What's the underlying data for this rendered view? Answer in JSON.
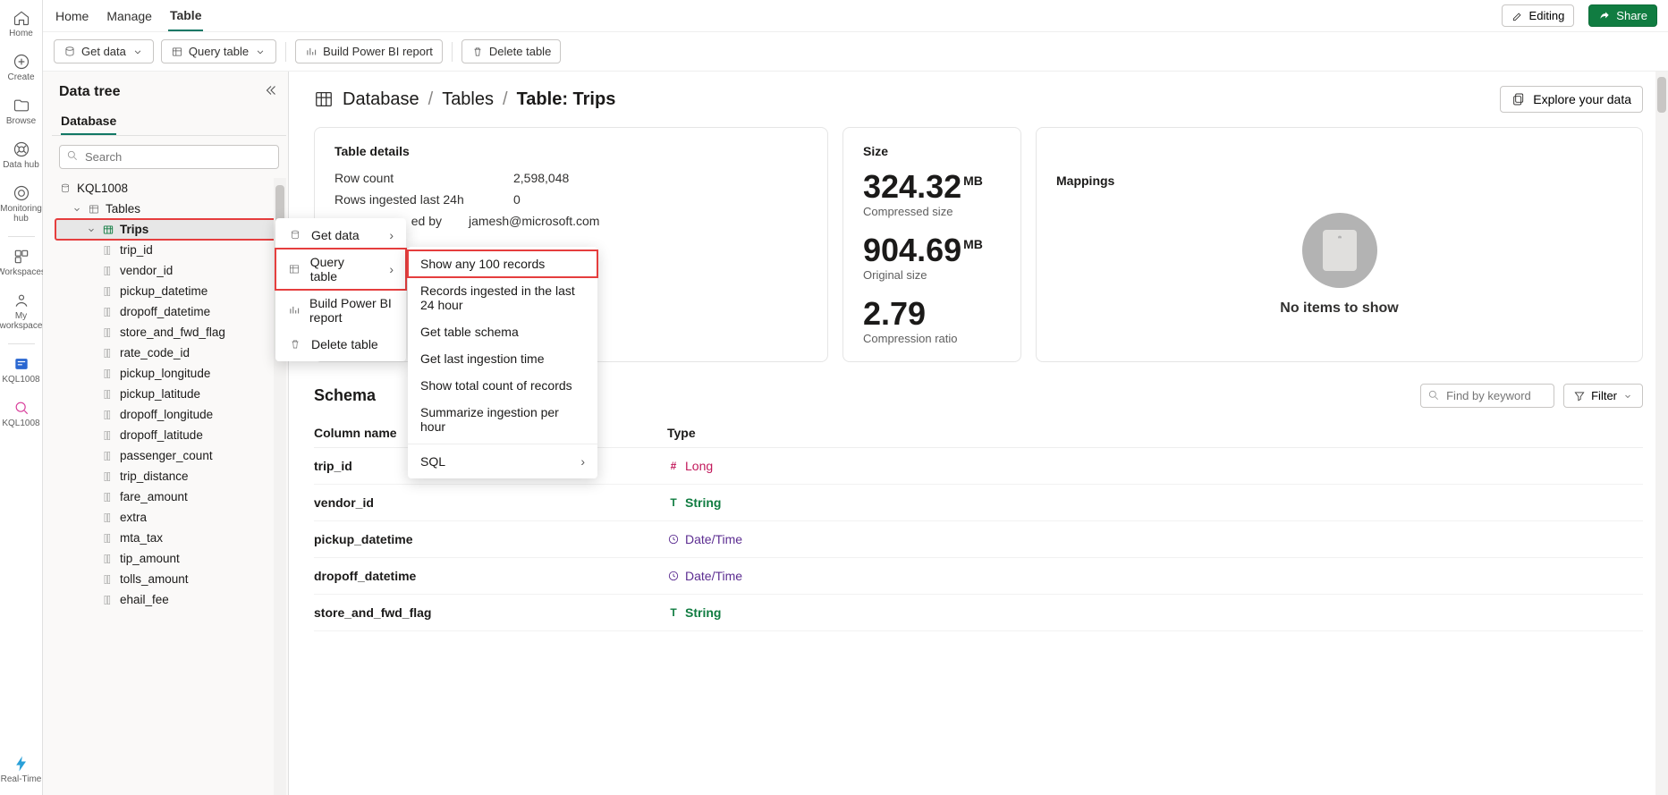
{
  "leftrail": {
    "items": [
      {
        "label": "Home"
      },
      {
        "label": "Create"
      },
      {
        "label": "Browse"
      },
      {
        "label": "Data hub"
      },
      {
        "label": "Monitoring hub"
      },
      {
        "label": "Workspaces"
      },
      {
        "label": "My workspace"
      },
      {
        "label": "KQL1008"
      },
      {
        "label": "KQL1008"
      }
    ],
    "bottom_label": "Real-Time"
  },
  "topTabs": {
    "items": [
      "Home",
      "Manage",
      "Table"
    ],
    "editing_label": "Editing",
    "share_label": "Share"
  },
  "ribbon": {
    "get_data": "Get data",
    "query_table": "Query table",
    "build_pbi": "Build Power BI report",
    "delete": "Delete table"
  },
  "dataTree": {
    "title": "Data tree",
    "tab_label": "Database",
    "search_placeholder": "Search",
    "root": "KQL1008",
    "tables_label": "Tables",
    "table_name": "Trips",
    "columns": [
      "trip_id",
      "vendor_id",
      "pickup_datetime",
      "dropoff_datetime",
      "store_and_fwd_flag",
      "rate_code_id",
      "pickup_longitude",
      "pickup_latitude",
      "dropoff_longitude",
      "dropoff_latitude",
      "passenger_count",
      "trip_distance",
      "fare_amount",
      "extra",
      "mta_tax",
      "tip_amount",
      "tolls_amount",
      "ehail_fee"
    ]
  },
  "breadcrumb": {
    "a": "Database",
    "b": "Tables",
    "c": "Table: Trips",
    "explore": "Explore your data"
  },
  "details": {
    "title": "Table details",
    "row_count_k": "Row count",
    "row_count_v": "2,598,048",
    "ingested_k": "Rows ingested last 24h",
    "ingested_v": "0",
    "createdby_k_suffix": "ed by",
    "createdby_v": "jamesh@microsoft.com"
  },
  "size": {
    "title": "Size",
    "compressed_val": "324.32",
    "compressed_unit": "MB",
    "compressed_label": "Compressed size",
    "original_val": "904.69",
    "original_unit": "MB",
    "original_label": "Original size",
    "ratio_val": "2.79",
    "ratio_label": "Compression ratio"
  },
  "mappings": {
    "title": "Mappings",
    "empty": "No items to show"
  },
  "schema": {
    "title": "Schema",
    "find_placeholder": "Find by keyword",
    "filter_label": "Filter",
    "col_name": "Column name",
    "col_type": "Type",
    "rows": [
      {
        "name": "trip_id",
        "type": "Long"
      },
      {
        "name": "vendor_id",
        "type": "String"
      },
      {
        "name": "pickup_datetime",
        "type": "Date/Time"
      },
      {
        "name": "dropoff_datetime",
        "type": "Date/Time"
      },
      {
        "name": "store_and_fwd_flag",
        "type": "String"
      }
    ]
  },
  "contextMenu": {
    "get_data": "Get data",
    "query_table": "Query table",
    "build_pbi": "Build Power BI report",
    "delete": "Delete table",
    "sub": {
      "r1": "Show any 100 records",
      "r2": "Records ingested in the last 24 hour",
      "r3": "Get table schema",
      "r4": "Get last ingestion time",
      "r5": "Show total count of records",
      "r6": "Summarize ingestion per hour",
      "r7": "SQL"
    }
  }
}
